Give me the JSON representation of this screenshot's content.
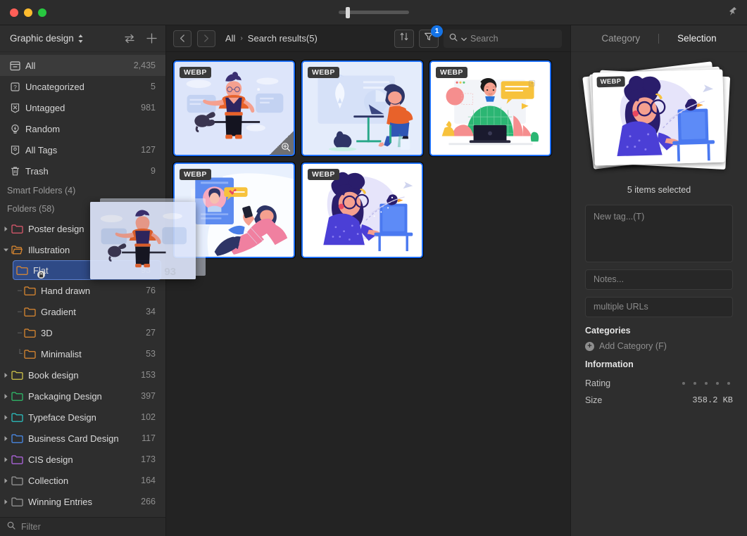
{
  "window": {
    "traffic_lights": [
      "close",
      "minimize",
      "maximize"
    ],
    "pin_icon": "pin-icon",
    "zoom_slider_value": 12
  },
  "sidebar": {
    "library_title": "Graphic design",
    "swap_icon": "swap-arrows-icon",
    "add_icon": "plus-icon",
    "filter_placeholder": "Filter",
    "filter_icon": "search-icon",
    "smart_items": [
      {
        "label": "All",
        "count": "2,435",
        "icon": "archive-box-icon",
        "active": true
      },
      {
        "label": "Uncategorized",
        "count": "5",
        "icon": "question-tag-icon",
        "active": false
      },
      {
        "label": "Untagged",
        "count": "981",
        "icon": "x-tag-icon",
        "active": false
      },
      {
        "label": "Random",
        "count": "",
        "icon": "lightbulb-icon",
        "active": false
      },
      {
        "label": "All Tags",
        "count": "127",
        "icon": "tag-bookmark-icon",
        "active": false
      },
      {
        "label": "Trash",
        "count": "9",
        "icon": "trash-icon",
        "active": false
      }
    ],
    "smart_folders_header": "Smart Folders (4)",
    "folders_header": "Folders (58)",
    "folders": [
      {
        "label": "Poster design",
        "count": "",
        "color": "#e05a6e",
        "twisty": "collapsed",
        "depth": 0,
        "selected": false,
        "locked": false
      },
      {
        "label": "Illustration",
        "count": "",
        "color": "#e08a30",
        "twisty": "expanded",
        "depth": 0,
        "selected": false,
        "locked": false
      },
      {
        "label": "Flat",
        "count": "93",
        "color": "#e08a30",
        "twisty": "none",
        "depth": 1,
        "selected": true,
        "locked": true
      },
      {
        "label": "Hand drawn",
        "count": "76",
        "color": "#e08a30",
        "twisty": "none",
        "depth": 1,
        "selected": false,
        "locked": false
      },
      {
        "label": "Gradient",
        "count": "34",
        "color": "#e08a30",
        "twisty": "none",
        "depth": 1,
        "selected": false,
        "locked": false
      },
      {
        "label": "3D",
        "count": "27",
        "color": "#e08a30",
        "twisty": "none",
        "depth": 1,
        "selected": false,
        "locked": false
      },
      {
        "label": "Minimalist",
        "count": "53",
        "color": "#e08a30",
        "twisty": "none",
        "depth": 1,
        "selected": false,
        "locked": false
      },
      {
        "label": "Book design",
        "count": "153",
        "color": "#d4c game",
        "twisty": "collapsed",
        "depth": 0,
        "selected": false,
        "locked": false
      },
      {
        "label": "Packaging Design",
        "count": "397",
        "color": "#2fbf6b",
        "twisty": "collapsed",
        "depth": 0,
        "selected": false,
        "locked": false
      },
      {
        "label": "Typeface Design",
        "count": "102",
        "color": "#2bc4c4",
        "twisty": "collapsed",
        "depth": 0,
        "selected": false,
        "locked": false
      },
      {
        "label": "Business Card Design",
        "count": "117",
        "color": "#4b8ef0",
        "twisty": "collapsed",
        "depth": 0,
        "selected": false,
        "locked": false
      },
      {
        "label": "CIS design",
        "count": "173",
        "color": "#b467e6",
        "twisty": "collapsed",
        "depth": 0,
        "selected": false,
        "locked": false
      },
      {
        "label": "Collection",
        "count": "164",
        "color": "#9a9a9a",
        "twisty": "collapsed",
        "depth": 0,
        "selected": false,
        "locked": false
      },
      {
        "label": "Winning Entries",
        "count": "266",
        "color": "#9a9a9a",
        "twisty": "collapsed",
        "depth": 0,
        "selected": false,
        "locked": false
      }
    ]
  },
  "toolbar": {
    "back_icon": "chevron-left-icon",
    "forward_icon": "chevron-right-icon",
    "breadcrumb_root": "All",
    "breadcrumb_separator": "›",
    "breadcrumb_current": "Search results(5)",
    "sort_icon": "sort-arrows-icon",
    "filter_icon": "funnel-icon",
    "filter_badge": "1",
    "search_icon": "search-icon",
    "search_chevron_icon": "chevron-down-icon",
    "search_placeholder": "Search",
    "search_value": ""
  },
  "grid": {
    "items": [
      {
        "format": "WEBP",
        "selected": true,
        "hovered": true,
        "bg": "#dde5fa",
        "alt": "flat illustration of a person with cat"
      },
      {
        "format": "WEBP",
        "selected": true,
        "hovered": false,
        "bg": "#e4ecfb",
        "alt": "person working at desk with cat"
      },
      {
        "format": "WEBP",
        "selected": true,
        "hovered": false,
        "bg": "#ffffff",
        "alt": "person in green sweater with laptop"
      },
      {
        "format": "WEBP",
        "selected": true,
        "hovered": false,
        "bg": "#e8f0fd",
        "alt": "person reclining with phone"
      },
      {
        "format": "WEBP",
        "selected": true,
        "hovered": false,
        "bg": "#ffffff",
        "alt": "woman at laptop with bird"
      }
    ]
  },
  "drag_preview": {
    "count": "93",
    "visible": true
  },
  "inspector": {
    "tab_category": "Category",
    "tab_selection": "Selection",
    "active_tab": "Selection",
    "preview_format": "WEBP",
    "selection_count_text": "5 items selected",
    "tag_placeholder": "New tag...(T)",
    "notes_placeholder": "Notes...",
    "urls_placeholder": "multiple URLs",
    "categories_title": "Categories",
    "add_category_label": "Add Category (F)",
    "add_category_icon": "plus-circle-icon",
    "information_title": "Information",
    "rating_label": "Rating",
    "rating_value": 0,
    "rating_max": 5,
    "size_label": "Size",
    "size_value": "358.2 KB"
  },
  "colors": {
    "accent": "#1d6ef5",
    "selection_blue": "#2f4a86",
    "sidebar_bg": "#2e2e2e",
    "content_bg": "#232323",
    "titlebar_bg": "#2c2c2c"
  }
}
